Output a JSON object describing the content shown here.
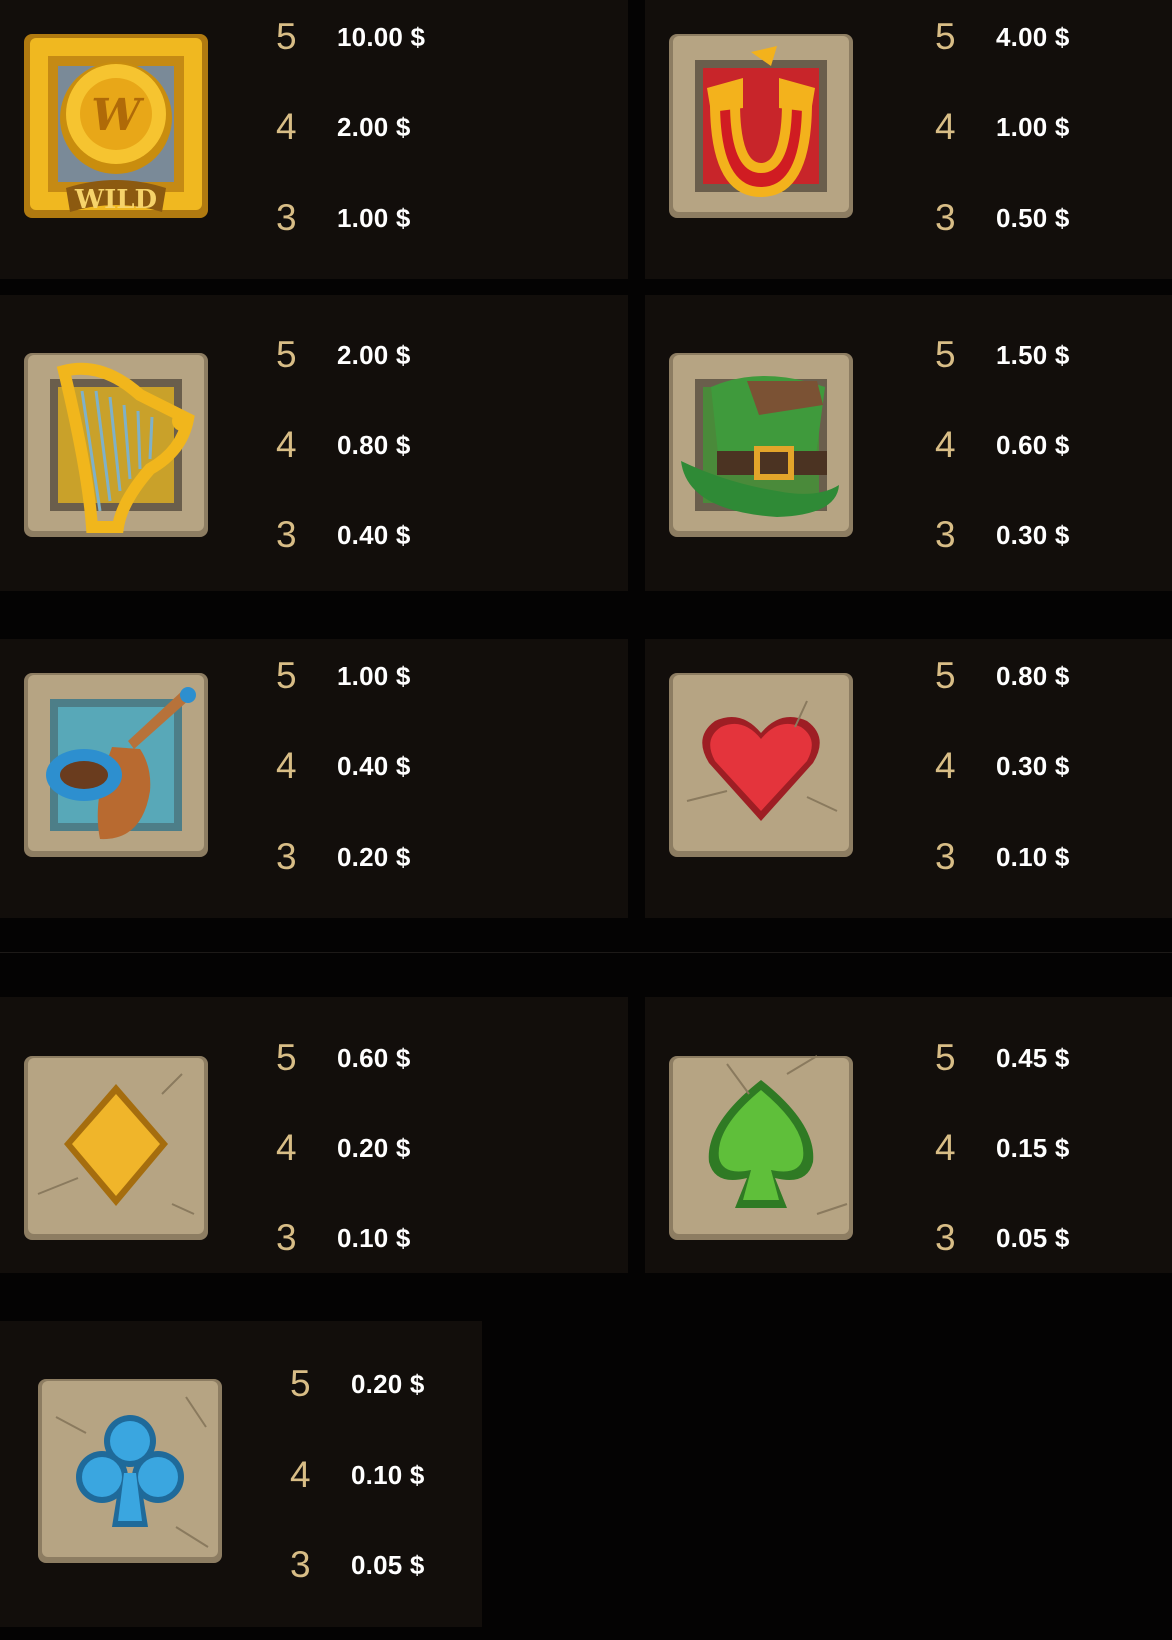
{
  "colors": {
    "background": "#040303",
    "card": "#120e0b",
    "count_text": "#d8bd86",
    "payout_text": "#ffffff"
  },
  "paytable": [
    {
      "name": "Wild",
      "icon": "wild-coin-icon",
      "payouts": [
        {
          "count": "5",
          "value": "10.00 $"
        },
        {
          "count": "4",
          "value": "2.00 $"
        },
        {
          "count": "3",
          "value": "1.00 $"
        }
      ]
    },
    {
      "name": "Horseshoe",
      "icon": "horseshoe-icon",
      "payouts": [
        {
          "count": "5",
          "value": "4.00 $"
        },
        {
          "count": "4",
          "value": "1.00 $"
        },
        {
          "count": "3",
          "value": "0.50 $"
        }
      ]
    },
    {
      "name": "Harp",
      "icon": "harp-icon",
      "payouts": [
        {
          "count": "5",
          "value": "2.00 $"
        },
        {
          "count": "4",
          "value": "0.80 $"
        },
        {
          "count": "3",
          "value": "0.40 $"
        }
      ]
    },
    {
      "name": "Leprechaun Hat",
      "icon": "leprechaun-hat-icon",
      "payouts": [
        {
          "count": "5",
          "value": "1.50 $"
        },
        {
          "count": "4",
          "value": "0.60 $"
        },
        {
          "count": "3",
          "value": "0.30 $"
        }
      ]
    },
    {
      "name": "Pipe",
      "icon": "pipe-icon",
      "payouts": [
        {
          "count": "5",
          "value": "1.00 $"
        },
        {
          "count": "4",
          "value": "0.40 $"
        },
        {
          "count": "3",
          "value": "0.20 $"
        }
      ]
    },
    {
      "name": "Heart",
      "icon": "heart-icon",
      "payouts": [
        {
          "count": "5",
          "value": "0.80 $"
        },
        {
          "count": "4",
          "value": "0.30 $"
        },
        {
          "count": "3",
          "value": "0.10 $"
        }
      ]
    },
    {
      "name": "Diamond",
      "icon": "diamond-icon",
      "payouts": [
        {
          "count": "5",
          "value": "0.60 $"
        },
        {
          "count": "4",
          "value": "0.20 $"
        },
        {
          "count": "3",
          "value": "0.10 $"
        }
      ]
    },
    {
      "name": "Spade",
      "icon": "spade-icon",
      "payouts": [
        {
          "count": "5",
          "value": "0.45 $"
        },
        {
          "count": "4",
          "value": "0.15 $"
        },
        {
          "count": "3",
          "value": "0.05 $"
        }
      ]
    },
    {
      "name": "Club",
      "icon": "club-icon",
      "payouts": [
        {
          "count": "5",
          "value": "0.20 $"
        },
        {
          "count": "4",
          "value": "0.10 $"
        },
        {
          "count": "3",
          "value": "0.05 $"
        }
      ]
    }
  ],
  "wild_label": "WILD"
}
